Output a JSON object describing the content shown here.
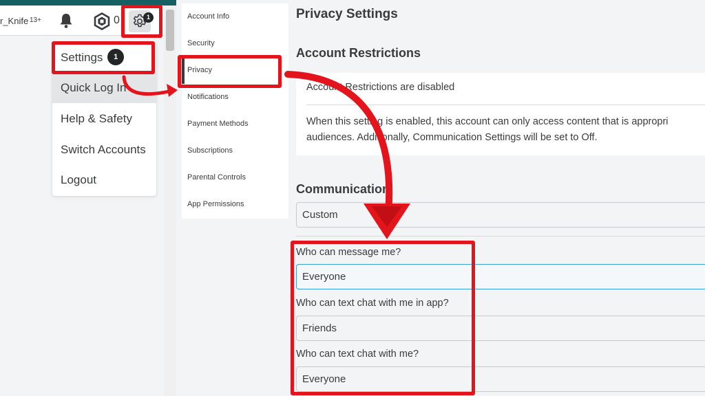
{
  "topbar": {
    "username": "r_Knife",
    "age_badge": "13+",
    "robux_count": "0",
    "settings_badge_count": "1"
  },
  "dropdown": {
    "items": [
      {
        "label": "Settings",
        "badge": "1"
      },
      {
        "label": "Quick Log In"
      },
      {
        "label": "Help & Safety"
      },
      {
        "label": "Switch Accounts"
      },
      {
        "label": "Logout"
      }
    ]
  },
  "settings_nav": {
    "items": [
      {
        "label": "Account Info"
      },
      {
        "label": "Security"
      },
      {
        "label": "Privacy"
      },
      {
        "label": "Notifications"
      },
      {
        "label": "Payment Methods"
      },
      {
        "label": "Subscriptions"
      },
      {
        "label": "Parental Controls"
      },
      {
        "label": "App Permissions"
      }
    ],
    "active": "Privacy"
  },
  "main": {
    "title": "Privacy Settings",
    "restrictions": {
      "heading": "Account Restrictions",
      "status": "Account Restrictions are disabled",
      "description_line1": "When this setting is enabled, this account can only access content that is appropri",
      "description_line2": "audiences. Additionally, Communication Settings will be set to Off."
    },
    "communication": {
      "heading": "Communication",
      "preset": "Custom",
      "questions": [
        {
          "label": "Who can message me?",
          "value": "Everyone"
        },
        {
          "label": "Who can text chat with me in app?",
          "value": "Friends"
        },
        {
          "label": "Who can text chat with me?",
          "value": "Everyone"
        }
      ]
    }
  },
  "colors": {
    "annotation_red": "#e3141b",
    "top_strip_teal": "#165f63",
    "focus_blue": "#3a9ed9",
    "badge_dark": "#232527"
  },
  "icons": [
    "bell-icon",
    "robux-icon",
    "gear-icon"
  ]
}
